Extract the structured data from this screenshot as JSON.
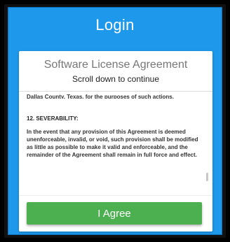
{
  "app": {
    "title": "Login"
  },
  "license": {
    "title": "Software License Agreement",
    "subtitle": "Scroll down to continue",
    "partial_line": "Dallas County, Texas, for the purposes of such actions.",
    "section_heading": "12. SEVERABILITY:",
    "section_body": "In the event that any provision of this Agreement is deemed unenforceable, invalid, or void, such provision shall be modified as little as possible to make it valid and enforceable, and the remainder of the Agreement shall remain in full force and effect."
  },
  "actions": {
    "agree_label": "I Agree"
  },
  "colors": {
    "header_background": "#1e98ea",
    "button_background": "#4caf50",
    "card_background": "#ffffff"
  }
}
